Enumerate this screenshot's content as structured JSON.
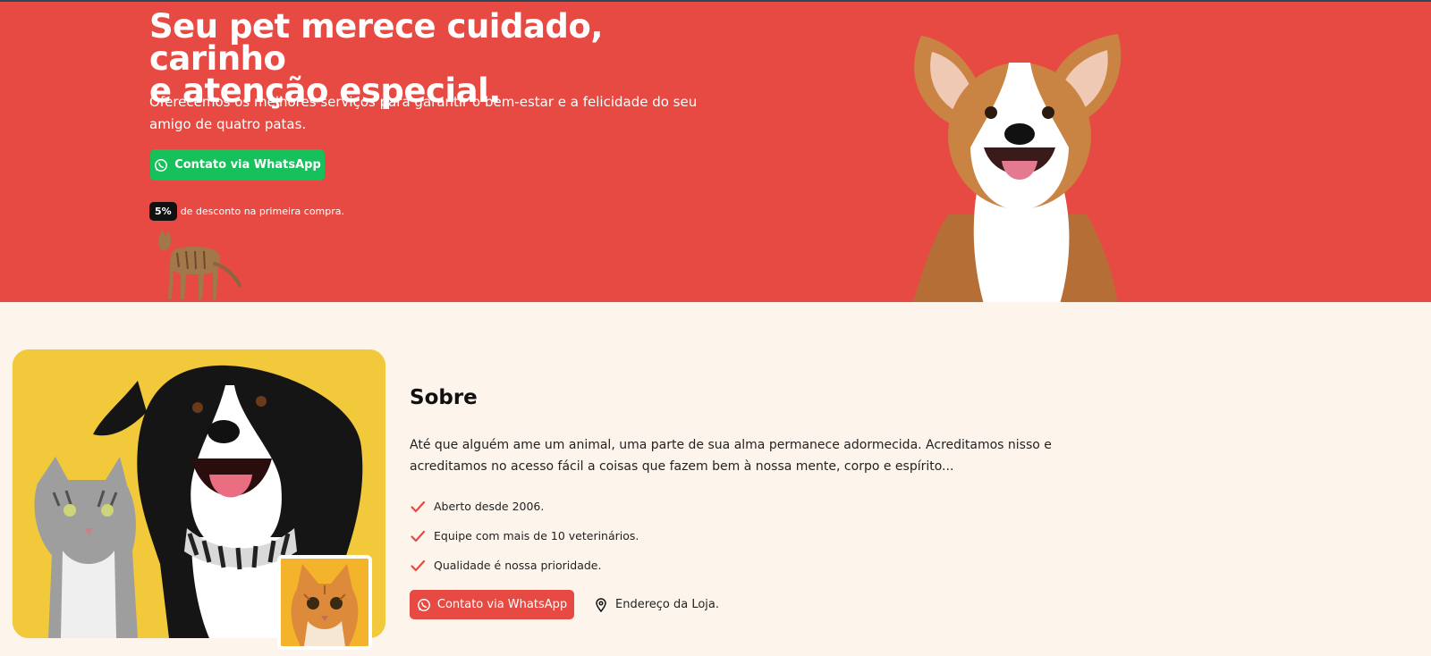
{
  "hero": {
    "title_line1": "Seu pet merece cuidado, carinho",
    "title_line2": "e atenção especial.",
    "subtitle": "Oferecemos os melhores serviços para garantir o bem-estar e a felicidade do seu amigo de quatro patas.",
    "cta_label": "Contato via WhatsApp",
    "discount_badge": "5%",
    "discount_text": "de desconto na primeira compra.",
    "colors": {
      "background": "#e64a42",
      "cta": "#16c05a"
    },
    "images": [
      "cat-image",
      "corgi-dog-image"
    ]
  },
  "about": {
    "title": "Sobre",
    "text": "Até que alguém ame um animal, uma parte de sua alma permanece adormecida. Acreditamos nisso e acreditamos no acesso fácil a coisas que fazem bem à nossa mente, corpo e espírito...",
    "features": [
      "Aberto desde 2006.",
      "Equipe com mais de 10 veterinários.",
      "Qualidade é nossa prioridade."
    ],
    "cta_label": "Contato via WhatsApp",
    "address_label": "Endereço da Loja.",
    "colors": {
      "background": "#fdf5ec",
      "accent": "#e64a42"
    },
    "icons": [
      "check-icon",
      "whatsapp-icon",
      "map-pin-icon"
    ]
  }
}
